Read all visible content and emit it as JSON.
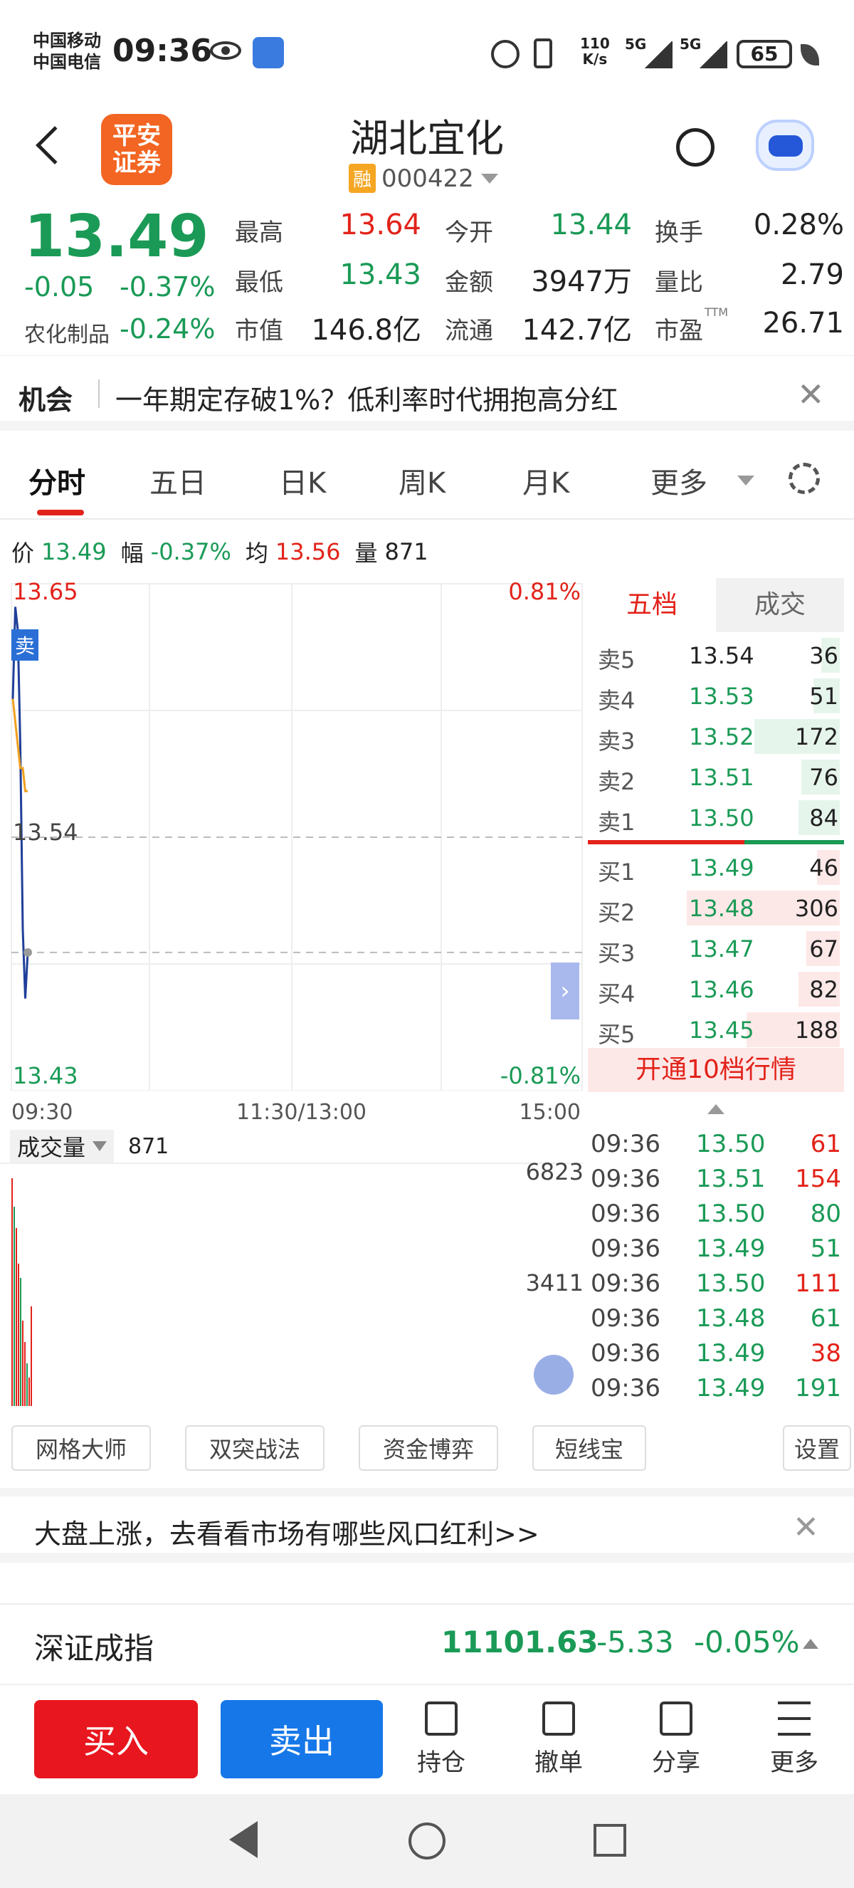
{
  "status": {
    "carrier1": "中国移动",
    "carrier2": "中国电信",
    "time": "09:36",
    "speed_top": "110",
    "speed_bottom": "K/s",
    "net1": "5G",
    "net2": "5G",
    "battery": "65"
  },
  "header": {
    "title": "湖北宜化",
    "badge": "融",
    "code": "000422",
    "logo_line1": "平安",
    "logo_line2": "证券"
  },
  "quote": {
    "price": "13.49",
    "change": "-0.05",
    "change_pct": "-0.37%",
    "sector": "农化制品",
    "sector_pct": "-0.24%",
    "fields": [
      {
        "label": "最高",
        "value": "13.64",
        "color": "red"
      },
      {
        "label": "今开",
        "value": "13.44",
        "color": "green"
      },
      {
        "label": "换手",
        "value": "0.28%",
        "color": "dark"
      },
      {
        "label": "最低",
        "value": "13.43",
        "color": "green"
      },
      {
        "label": "金额",
        "value": "3947万",
        "color": "dark"
      },
      {
        "label": "量比",
        "value": "2.79",
        "color": "dark"
      },
      {
        "label": "市值",
        "value": "146.8亿",
        "color": "dark"
      },
      {
        "label": "流通",
        "value": "142.7亿",
        "color": "dark"
      },
      {
        "label": "市盈",
        "value": "26.71",
        "color": "dark"
      }
    ],
    "ttm": "TTM"
  },
  "news": {
    "tag": "机会",
    "text": "一年期定存破1%？低利率时代拥抱高分红"
  },
  "tabs": [
    "分时",
    "五日",
    "日K",
    "周K",
    "月K",
    "更多"
  ],
  "info": {
    "price_label": "价",
    "price": "13.49",
    "amp_label": "幅",
    "amp": "-0.37%",
    "avg_label": "均",
    "avg": "13.56",
    "vol_label": "量",
    "vol": "871"
  },
  "chart": {
    "top_price": "13.65",
    "top_pct": "0.81%",
    "mid_price": "13.54",
    "bottom_price": "13.43",
    "bottom_pct": "-0.81%",
    "sell_marker": "卖"
  },
  "chart_data": {
    "type": "line",
    "x": [
      "09:30",
      "09:31",
      "09:32",
      "09:33",
      "09:34",
      "09:35",
      "09:36"
    ],
    "series": [
      {
        "values": [
          13.6,
          13.64,
          13.63,
          13.58,
          13.5,
          13.47,
          13.49
        ]
      },
      {
        "values": [
          13.6,
          13.59,
          13.58,
          13.57,
          13.57,
          13.56,
          13.56
        ]
      }
    ],
    "ylim": [
      13.43,
      13.65
    ],
    "x_ticks": [
      "09:30",
      "11:30/13:00",
      "15:00"
    ]
  },
  "book": {
    "tab1": "五档",
    "tab2": "成交",
    "asks": [
      {
        "label": "卖5",
        "price": "13.54",
        "vol": "36",
        "price_color": "dark",
        "bar": 0.12
      },
      {
        "label": "卖4",
        "price": "13.53",
        "vol": "51",
        "price_color": "green",
        "bar": 0.17
      },
      {
        "label": "卖3",
        "price": "13.52",
        "vol": "172",
        "price_color": "green",
        "bar": 0.56
      },
      {
        "label": "卖2",
        "price": "13.51",
        "vol": "76",
        "price_color": "green",
        "bar": 0.25
      },
      {
        "label": "卖1",
        "price": "13.50",
        "vol": "84",
        "price_color": "green",
        "bar": 0.27
      }
    ],
    "bids": [
      {
        "label": "买1",
        "price": "13.49",
        "vol": "46",
        "price_color": "green",
        "bar": 0.15
      },
      {
        "label": "买2",
        "price": "13.48",
        "vol": "306",
        "price_color": "green",
        "bar": 1.0
      },
      {
        "label": "买3",
        "price": "13.47",
        "vol": "67",
        "price_color": "green",
        "bar": 0.22
      },
      {
        "label": "买4",
        "price": "13.46",
        "vol": "82",
        "price_color": "green",
        "bar": 0.27
      },
      {
        "label": "买5",
        "price": "13.45",
        "vol": "188",
        "price_color": "green",
        "bar": 0.61
      }
    ],
    "upgrade": "开通10档行情"
  },
  "volume": {
    "label": "成交量",
    "value": "871",
    "max": "6823",
    "mid": "3411"
  },
  "trades": [
    {
      "time": "09:36",
      "price": "13.50",
      "vol": "61",
      "vol_color": "red"
    },
    {
      "time": "09:36",
      "price": "13.51",
      "vol": "154",
      "vol_color": "red"
    },
    {
      "time": "09:36",
      "price": "13.50",
      "vol": "80",
      "vol_color": "green"
    },
    {
      "time": "09:36",
      "price": "13.49",
      "vol": "51",
      "vol_color": "green"
    },
    {
      "time": "09:36",
      "price": "13.50",
      "vol": "111",
      "vol_color": "red"
    },
    {
      "time": "09:36",
      "price": "13.48",
      "vol": "61",
      "vol_color": "green"
    },
    {
      "time": "09:36",
      "price": "13.49",
      "vol": "38",
      "vol_color": "red"
    },
    {
      "time": "09:36",
      "price": "13.49",
      "vol": "191",
      "vol_color": "green"
    }
  ],
  "tools": [
    "网格大师",
    "双突战法",
    "资金博弈",
    "短线宝",
    "设置"
  ],
  "promo": {
    "text": "大盘上涨，去看看市场有哪些风口红利>>"
  },
  "index": {
    "name": "深证成指",
    "value": "11101.63",
    "change": "-5.33",
    "pct": "-0.05%"
  },
  "actions": {
    "buy": "买入",
    "sell": "卖出",
    "hold": "持仓",
    "cancel": "撤单",
    "share": "分享",
    "more": "更多"
  },
  "colors": {
    "red": "#e2231a",
    "green": "#1a9a56",
    "blue": "#1677e8",
    "line_price": "#1f3f99",
    "line_avg": "#f0a020"
  }
}
